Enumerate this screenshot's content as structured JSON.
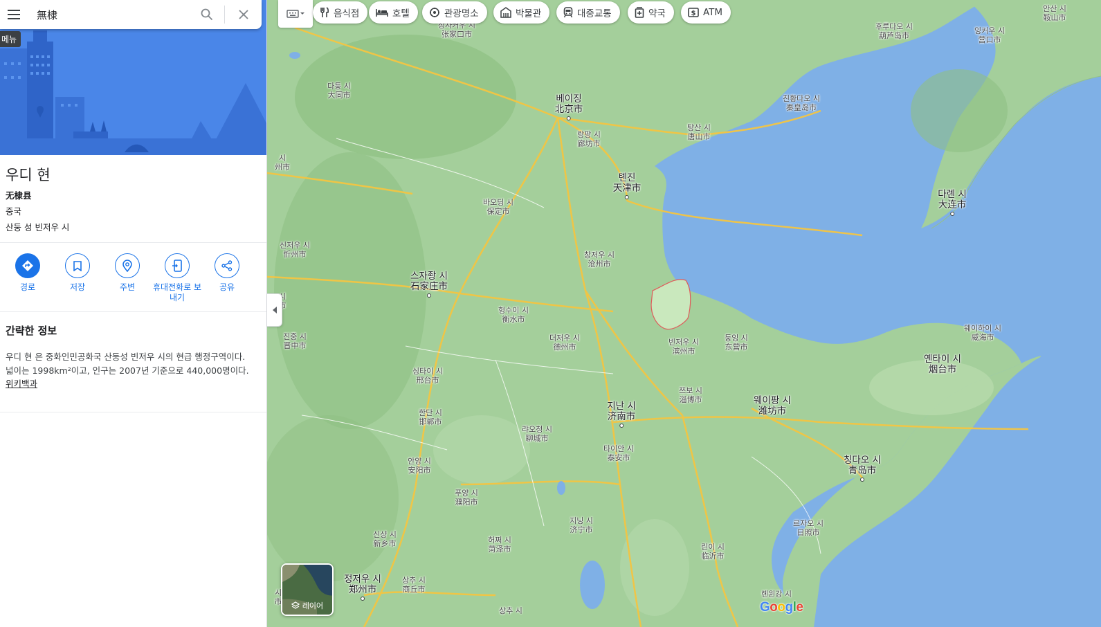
{
  "search": {
    "value": "無棣",
    "menu_tooltip": "메뉴"
  },
  "place": {
    "title": "우디 현",
    "native_name": "无棣县",
    "country": "중국",
    "region": "산둥 성 빈저우 시"
  },
  "actions": [
    {
      "label": "경로",
      "icon": "directions-icon"
    },
    {
      "label": "저장",
      "icon": "bookmark-icon"
    },
    {
      "label": "주변",
      "icon": "nearby-icon"
    },
    {
      "label": "휴대전화로 보내기",
      "icon": "send-to-phone-icon"
    },
    {
      "label": "공유",
      "icon": "share-icon"
    }
  ],
  "info": {
    "heading": "간략한 정보",
    "text": "우디 현 은 중화인민공화국 산둥성 빈저우 시의 현급 행정구역이다. 넓이는 1998km²이고, 인구는 2007년 기준으로 440,000명이다. ",
    "link": "위키백과"
  },
  "map": {
    "chips": [
      {
        "label": "음식점",
        "icon": "restaurant-icon"
      },
      {
        "label": "호텔",
        "icon": "hotel-icon"
      },
      {
        "label": "관광명소",
        "icon": "attraction-icon"
      },
      {
        "label": "박물관",
        "icon": "museum-icon"
      },
      {
        "label": "대중교통",
        "icon": "transit-icon"
      },
      {
        "label": "약국",
        "icon": "pharmacy-icon"
      },
      {
        "label": "ATM",
        "icon": "atm-icon"
      }
    ],
    "layer_label": "레이어",
    "logo": "Google",
    "cities": [
      {
        "ko": "베이징",
        "zh": "北京市"
      },
      {
        "ko": "톈진",
        "zh": "天津市"
      },
      {
        "ko": "스자좡 시",
        "zh": "石家庄市"
      },
      {
        "ko": "지난 시",
        "zh": "济南市"
      },
      {
        "ko": "칭다오 시",
        "zh": "青岛市"
      },
      {
        "ko": "웨이팡 시",
        "zh": "潍坊市"
      },
      {
        "ko": "옌타이 시",
        "zh": "烟台市"
      },
      {
        "ko": "다롄 시",
        "zh": "大连市"
      },
      {
        "ko": "정저우 시",
        "zh": "郑州市"
      },
      {
        "ko": "장자커우 시",
        "zh": "张家口市"
      },
      {
        "ko": "다퉁 시",
        "zh": "大同市"
      },
      {
        "ko": "랑팡 시",
        "zh": "廊坊市"
      },
      {
        "ko": "탕산 시",
        "zh": "唐山市"
      },
      {
        "ko": "친황다오 시",
        "zh": "秦皇岛市"
      },
      {
        "ko": "후루다오 시",
        "zh": "葫芦岛市"
      },
      {
        "ko": "잉커우 시",
        "zh": "营口市"
      },
      {
        "ko": "안산 시",
        "zh": "鞍山市"
      },
      {
        "ko": "바오딩 시",
        "zh": "保定市"
      },
      {
        "ko": "창저우 시",
        "zh": "沧州市"
      },
      {
        "ko": "헝수이 시",
        "zh": "衡水市"
      },
      {
        "ko": "더저우 시",
        "zh": "德州市"
      },
      {
        "ko": "빈저우 시",
        "zh": "滨州市"
      },
      {
        "ko": "둥잉 시",
        "zh": "东营市"
      },
      {
        "ko": "쯔보 시",
        "zh": "淄博市"
      },
      {
        "ko": "웨이하이 시",
        "zh": "威海市"
      },
      {
        "ko": "싱타이 시",
        "zh": "邢台市"
      },
      {
        "ko": "한단 시",
        "zh": "邯郸市"
      },
      {
        "ko": "랴오청 시",
        "zh": "聊城市"
      },
      {
        "ko": "타이안 시",
        "zh": "泰安市"
      },
      {
        "ko": "안양 시",
        "zh": "安阳市"
      },
      {
        "ko": "푸양 시",
        "zh": "濮阳市"
      },
      {
        "ko": "지닝 시",
        "zh": "济宁市"
      },
      {
        "ko": "신샹 시",
        "zh": "新乡市"
      },
      {
        "ko": "허쩌 시",
        "zh": "菏泽市"
      },
      {
        "ko": "린이 시",
        "zh": "临沂市"
      },
      {
        "ko": "르자오 시",
        "zh": "日照市"
      },
      {
        "ko": "롄윈강 시",
        "zh": ""
      },
      {
        "ko": "신저우 시",
        "zh": "忻州市"
      },
      {
        "ko": "진중 시",
        "zh": "晋中市"
      },
      {
        "ko": "상추 시",
        "zh": ""
      },
      {
        "ko": "상추 시",
        "zh": "商丘市"
      },
      {
        "ko": "시",
        "zh": "州市"
      },
      {
        "ko": "시",
        "zh": "市"
      },
      {
        "ko": "시",
        "zh": "市"
      }
    ]
  }
}
